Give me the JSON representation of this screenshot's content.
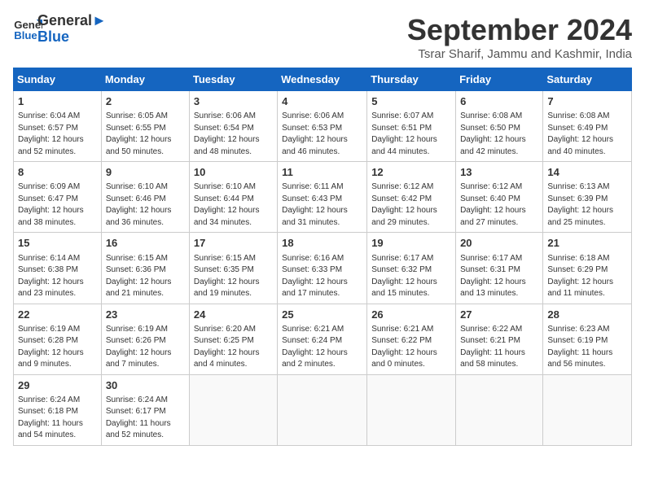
{
  "header": {
    "logo_general": "General",
    "logo_blue": "Blue",
    "month_title": "September 2024",
    "subtitle": "Tsrar Sharif, Jammu and Kashmir, India"
  },
  "weekdays": [
    "Sunday",
    "Monday",
    "Tuesday",
    "Wednesday",
    "Thursday",
    "Friday",
    "Saturday"
  ],
  "weeks": [
    [
      {
        "day": "1",
        "sunrise": "6:04 AM",
        "sunset": "6:57 PM",
        "daylight": "12 hours and 52 minutes."
      },
      {
        "day": "2",
        "sunrise": "6:05 AM",
        "sunset": "6:55 PM",
        "daylight": "12 hours and 50 minutes."
      },
      {
        "day": "3",
        "sunrise": "6:06 AM",
        "sunset": "6:54 PM",
        "daylight": "12 hours and 48 minutes."
      },
      {
        "day": "4",
        "sunrise": "6:06 AM",
        "sunset": "6:53 PM",
        "daylight": "12 hours and 46 minutes."
      },
      {
        "day": "5",
        "sunrise": "6:07 AM",
        "sunset": "6:51 PM",
        "daylight": "12 hours and 44 minutes."
      },
      {
        "day": "6",
        "sunrise": "6:08 AM",
        "sunset": "6:50 PM",
        "daylight": "12 hours and 42 minutes."
      },
      {
        "day": "7",
        "sunrise": "6:08 AM",
        "sunset": "6:49 PM",
        "daylight": "12 hours and 40 minutes."
      }
    ],
    [
      {
        "day": "8",
        "sunrise": "6:09 AM",
        "sunset": "6:47 PM",
        "daylight": "12 hours and 38 minutes."
      },
      {
        "day": "9",
        "sunrise": "6:10 AM",
        "sunset": "6:46 PM",
        "daylight": "12 hours and 36 minutes."
      },
      {
        "day": "10",
        "sunrise": "6:10 AM",
        "sunset": "6:44 PM",
        "daylight": "12 hours and 34 minutes."
      },
      {
        "day": "11",
        "sunrise": "6:11 AM",
        "sunset": "6:43 PM",
        "daylight": "12 hours and 31 minutes."
      },
      {
        "day": "12",
        "sunrise": "6:12 AM",
        "sunset": "6:42 PM",
        "daylight": "12 hours and 29 minutes."
      },
      {
        "day": "13",
        "sunrise": "6:12 AM",
        "sunset": "6:40 PM",
        "daylight": "12 hours and 27 minutes."
      },
      {
        "day": "14",
        "sunrise": "6:13 AM",
        "sunset": "6:39 PM",
        "daylight": "12 hours and 25 minutes."
      }
    ],
    [
      {
        "day": "15",
        "sunrise": "6:14 AM",
        "sunset": "6:38 PM",
        "daylight": "12 hours and 23 minutes."
      },
      {
        "day": "16",
        "sunrise": "6:15 AM",
        "sunset": "6:36 PM",
        "daylight": "12 hours and 21 minutes."
      },
      {
        "day": "17",
        "sunrise": "6:15 AM",
        "sunset": "6:35 PM",
        "daylight": "12 hours and 19 minutes."
      },
      {
        "day": "18",
        "sunrise": "6:16 AM",
        "sunset": "6:33 PM",
        "daylight": "12 hours and 17 minutes."
      },
      {
        "day": "19",
        "sunrise": "6:17 AM",
        "sunset": "6:32 PM",
        "daylight": "12 hours and 15 minutes."
      },
      {
        "day": "20",
        "sunrise": "6:17 AM",
        "sunset": "6:31 PM",
        "daylight": "12 hours and 13 minutes."
      },
      {
        "day": "21",
        "sunrise": "6:18 AM",
        "sunset": "6:29 PM",
        "daylight": "12 hours and 11 minutes."
      }
    ],
    [
      {
        "day": "22",
        "sunrise": "6:19 AM",
        "sunset": "6:28 PM",
        "daylight": "12 hours and 9 minutes."
      },
      {
        "day": "23",
        "sunrise": "6:19 AM",
        "sunset": "6:26 PM",
        "daylight": "12 hours and 7 minutes."
      },
      {
        "day": "24",
        "sunrise": "6:20 AM",
        "sunset": "6:25 PM",
        "daylight": "12 hours and 4 minutes."
      },
      {
        "day": "25",
        "sunrise": "6:21 AM",
        "sunset": "6:24 PM",
        "daylight": "12 hours and 2 minutes."
      },
      {
        "day": "26",
        "sunrise": "6:21 AM",
        "sunset": "6:22 PM",
        "daylight": "12 hours and 0 minutes."
      },
      {
        "day": "27",
        "sunrise": "6:22 AM",
        "sunset": "6:21 PM",
        "daylight": "11 hours and 58 minutes."
      },
      {
        "day": "28",
        "sunrise": "6:23 AM",
        "sunset": "6:19 PM",
        "daylight": "11 hours and 56 minutes."
      }
    ],
    [
      {
        "day": "29",
        "sunrise": "6:24 AM",
        "sunset": "6:18 PM",
        "daylight": "11 hours and 54 minutes."
      },
      {
        "day": "30",
        "sunrise": "6:24 AM",
        "sunset": "6:17 PM",
        "daylight": "11 hours and 52 minutes."
      },
      null,
      null,
      null,
      null,
      null
    ]
  ],
  "labels": {
    "sunrise": "Sunrise:",
    "sunset": "Sunset:",
    "daylight": "Daylight:"
  }
}
